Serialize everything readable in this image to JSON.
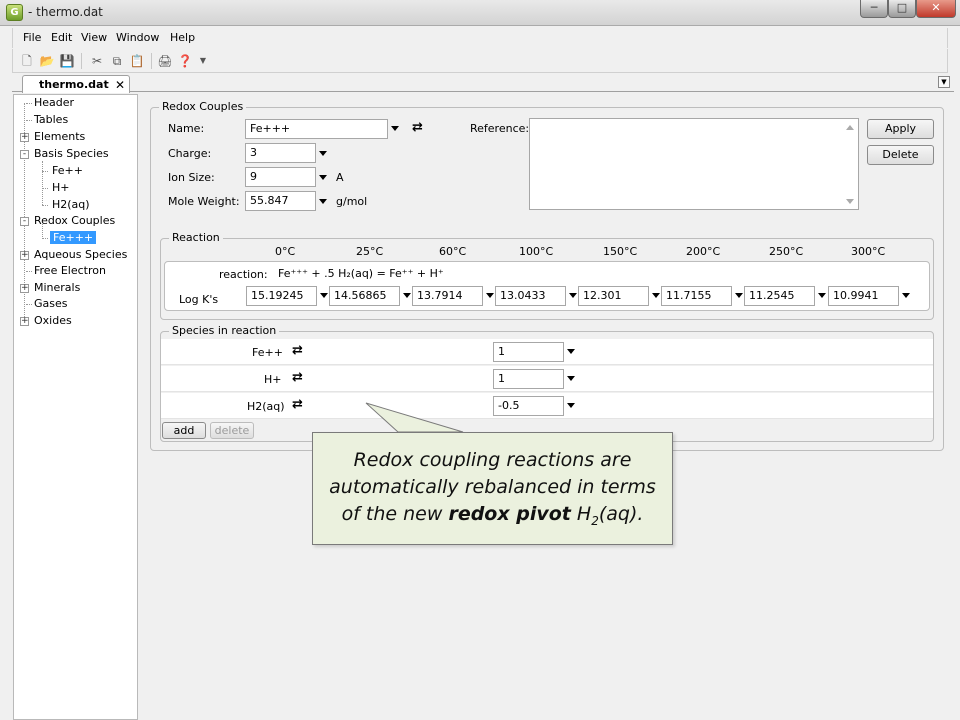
{
  "window": {
    "app_icon_letter": "G",
    "title": "- thermo.dat"
  },
  "menu": [
    "File",
    "Edit",
    "View",
    "Window",
    "Help"
  ],
  "tab": {
    "label": "thermo.dat"
  },
  "tree": {
    "items": [
      {
        "label": "Header",
        "level": 0,
        "expander": ""
      },
      {
        "label": "Tables",
        "level": 0,
        "expander": ""
      },
      {
        "label": "Elements",
        "level": 0,
        "expander": "+"
      },
      {
        "label": "Basis Species",
        "level": 0,
        "expander": "-"
      },
      {
        "label": "Fe++",
        "level": 1,
        "expander": ""
      },
      {
        "label": "H+",
        "level": 1,
        "expander": ""
      },
      {
        "label": "H2(aq)",
        "level": 1,
        "expander": ""
      },
      {
        "label": "Redox Couples",
        "level": 0,
        "expander": "-"
      },
      {
        "label": "Fe+++",
        "level": 1,
        "expander": "",
        "selected": true
      },
      {
        "label": "Aqueous Species",
        "level": 0,
        "expander": "+"
      },
      {
        "label": "Free Electron",
        "level": 0,
        "expander": ""
      },
      {
        "label": "Minerals",
        "level": 0,
        "expander": "+"
      },
      {
        "label": "Gases",
        "level": 0,
        "expander": ""
      },
      {
        "label": "Oxides",
        "level": 0,
        "expander": "+"
      }
    ]
  },
  "redox": {
    "group_title": "Redox Couples",
    "name_label": "Name:",
    "name_value": "Fe+++",
    "charge_label": "Charge:",
    "charge_value": "3",
    "ion_size_label": "Ion Size:",
    "ion_size_value": "9",
    "ion_size_unit": "A",
    "mole_weight_label": "Mole Weight:",
    "mole_weight_value": "55.847",
    "mole_weight_unit": "g/mol",
    "reference_label": "Reference:",
    "apply_label": "Apply",
    "delete_label": "Delete"
  },
  "reaction": {
    "group_title": "Reaction",
    "temperatures": [
      "0°C",
      "25°C",
      "60°C",
      "100°C",
      "150°C",
      "200°C",
      "250°C",
      "300°C"
    ],
    "reaction_label": "reaction:",
    "equation": "Fe⁺⁺⁺ + .5 H₂(aq)  = Fe⁺⁺  + H⁺",
    "logk_label": "Log K's",
    "logk_values": [
      "15.19245",
      "14.56865",
      "13.7914",
      "13.0433",
      "12.301",
      "11.7155",
      "11.2545",
      "10.9941"
    ]
  },
  "species": {
    "group_title": "Species in reaction",
    "rows": [
      {
        "name": "Fe++",
        "coef": "1"
      },
      {
        "name": "H+",
        "coef": "1"
      },
      {
        "name": "H2(aq)",
        "coef": "-0.5"
      }
    ],
    "add_label": "add",
    "delete_label": "delete"
  },
  "callout": {
    "line1": "Redox coupling reactions are",
    "line2": "automatically rebalanced  in terms",
    "line3_pre": "of the new ",
    "line3_bold": "redox pivot",
    "line3_h": " H",
    "line3_sub": "2",
    "line3_post": "(aq)."
  }
}
